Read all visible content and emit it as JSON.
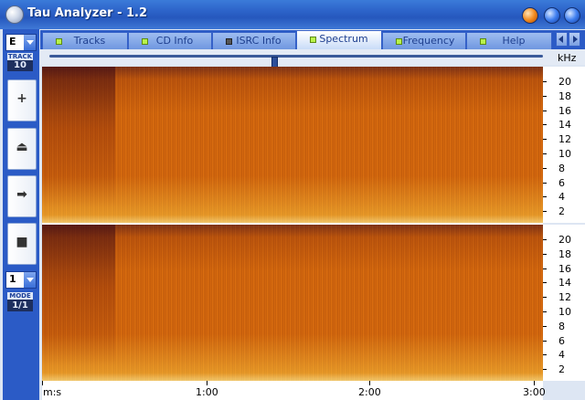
{
  "window": {
    "title": "Tau Analyzer - 1.2"
  },
  "left_panel": {
    "drive_letter": "E",
    "track_label": "TRACK",
    "track_number": "10",
    "controls": [
      {
        "name": "add-button",
        "glyph": "+"
      },
      {
        "name": "eject-button",
        "glyph": "⏏"
      },
      {
        "name": "play-button",
        "glyph": "➡"
      },
      {
        "name": "stop-button",
        "glyph": "■"
      }
    ],
    "mode_select_value": "1",
    "mode_label": "MODE",
    "mode_value": "1/1"
  },
  "tabs": [
    {
      "label": "Tracks",
      "led": "on"
    },
    {
      "label": "CD Info",
      "led": "on"
    },
    {
      "label": "ISRC Info",
      "led": "off"
    },
    {
      "label": "Spectrum",
      "led": "on",
      "active": true
    },
    {
      "label": "Frequency",
      "led": "on"
    },
    {
      "label": "Help",
      "led": "on"
    }
  ],
  "spectrum": {
    "freq_unit": "kHz",
    "freq_ticks": [
      "20",
      "18",
      "16",
      "14",
      "12",
      "10",
      "8",
      "6",
      "4",
      "2"
    ],
    "time_axis_labels": [
      "m:s",
      "1:00",
      "2:00",
      "3:00"
    ],
    "position_fraction": 0.45
  },
  "colors": {
    "title_bar": "#2c62c8",
    "spectrum_hot": "#f2a13a",
    "spectrum_base": "#d86a0e"
  }
}
